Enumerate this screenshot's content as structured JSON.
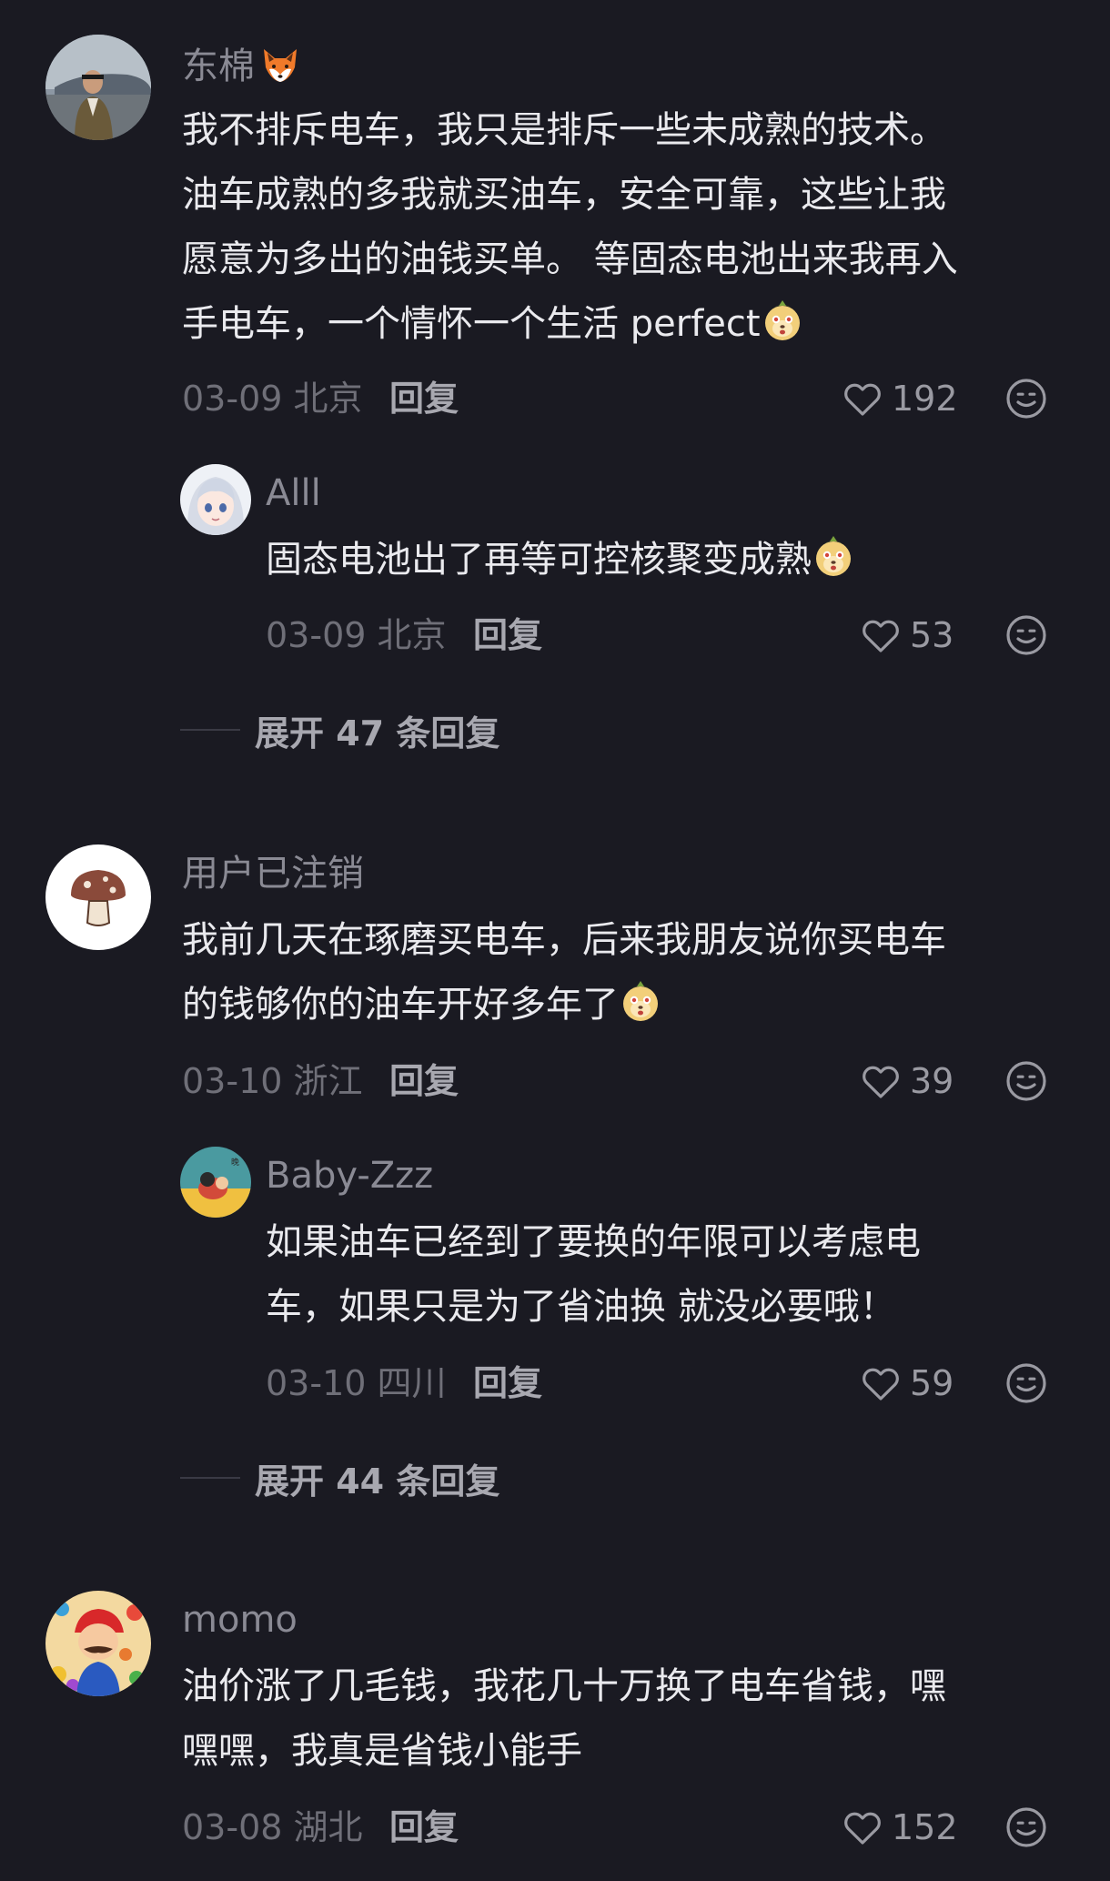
{
  "comments": [
    {
      "user": "东棉",
      "user_emoji": "fox-emoji",
      "lines": [
        "我不排斥电车，我只是排斥一些未成熟的技术。",
        "油车成熟的多我就买油车，安全可靠，这些让我",
        "愿意为多出的油钱买单。 等固态电池出来我再入",
        "手电车，一个情怀一个生活 perfect"
      ],
      "date_loc": "03-09 北京",
      "reply_label": "回复",
      "likes": "192",
      "reply": {
        "user": "Alll",
        "lines": [
          "固态电池出了再等可控核聚变成熟"
        ],
        "date_loc": "03-09 北京",
        "reply_label": "回复",
        "likes": "53"
      },
      "expand": "展开 47 条回复"
    },
    {
      "user": "用户已注销",
      "lines": [
        "我前几天在琢磨买电车，后来我朋友说你买电车",
        "的钱够你的油车开好多年了"
      ],
      "date_loc": "03-10 浙江",
      "reply_label": "回复",
      "likes": "39",
      "reply": {
        "user": "Baby-Zzz",
        "lines": [
          "如果油车已经到了要换的年限可以考虑电",
          "车，如果只是为了省油换 就没必要哦！"
        ],
        "date_loc": "03-10 四川",
        "reply_label": "回复",
        "likes": "59"
      },
      "expand": "展开 44 条回复"
    },
    {
      "user": "momo",
      "lines": [
        "油价涨了几毛钱，我花几十万换了电车省钱，嘿",
        "嘿嘿，我真是省钱小能手"
      ],
      "date_loc": "03-08 湖北",
      "reply_label": "回复",
      "likes": "152"
    }
  ],
  "colors": {
    "background": "#1a1a22",
    "text": "#eaeaee",
    "muted": "#8a8a94"
  }
}
